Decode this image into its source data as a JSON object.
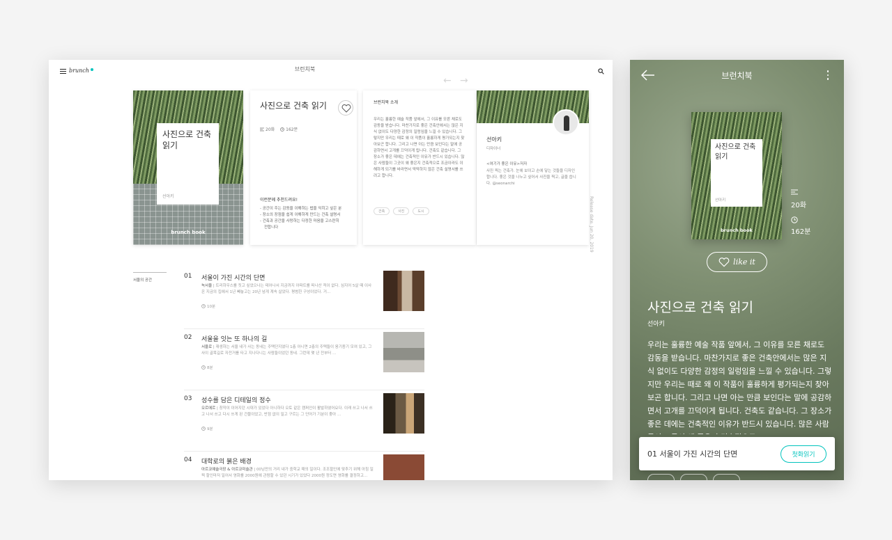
{
  "desktop": {
    "header": {
      "logo": "brunch",
      "title": "브런치북"
    },
    "nav": {
      "prev": "←",
      "next": "→"
    },
    "cover": {
      "title": "사진으로 건축 읽기",
      "author": "선아키",
      "brand": "brunch book"
    },
    "info": {
      "title": "사진으로 건축 읽기",
      "episodes": "20화",
      "duration": "162분",
      "recommend_head": "이런분께 추천드려요!",
      "recommend": [
        "- 공간이 주는 감동을 이해하는 법을 익히고 싶은 분",
        "- 장소의 장점을 쉽게 이해하게 만드는 건축 설명서",
        "- 건축과 공간을 사랑하는 다정한 마음을 고스란히",
        "전합니다"
      ]
    },
    "intro": {
      "head": "브런치북 소개",
      "body": "우리는 훌륭한 예술 작품 앞에서, 그 이유를 모른 채로도 감동을 받습니다. 마찬가지로 좋은 건축안에서는 많은 지식 없이도 다양한 감정의 일렁임을 느낄 수 있습니다. 그렇지만 우리는 때로 왜 이 작품이 훌륭하게 평가되는지 찾아보곤 합니다. 그리고 나면 아는 만큼 보인다는 말에 공감하면서 고개를 끄덕이게 됩니다. 건축도 같습니다. 그 장소가 좋은 데에는 건축적인 이유가 반드시 있습니다. 많은 사람들이 그곳이 왜 좋은지 건축적으로 조금이라도 이해하게 되기를 바라면서 딱딱하지 않은 건축 설명서를 쓰려고 합니다.",
      "tags": [
        "건축",
        "사진",
        "도시"
      ]
    },
    "author": {
      "name": "선아키",
      "role": "디자이너",
      "why": "<여기가 좋은 이유>저자",
      "bio": "사진 찍는 건축가. 눈에 보이고 손에 닿는 것들을 디자인합니다. 좋은 것을 나누고 싶어서 사진을 찍고, 글을 씁니다. @seonarchi"
    },
    "release": "Release date. Jun 20. 2019",
    "toc_label": "서울의 공간",
    "toc": [
      {
        "num": "01",
        "title": "서울이 가진 시간의 단면",
        "place": "녹서울",
        "desc": "트리하우스를 짓고 싶었으나는 테어나서 지금까지 아파트를 떠나산 적이 없다. 심지어 5살 때 이사 온 지금의 집에서 1년 빼놓고는 20년 넘게 계속 살았다. 평범한 구성이었다. 거…",
        "time": "10분"
      },
      {
        "num": "02",
        "title": "서울을 잇는 또 하나의 길",
        "place": "서울로",
        "desc": "재생하는 서울 내가 사는 동네는 주택단지였다 1층 아니면 2층의 주택들이 옹기종기 모여 있고, 그 사이 골목길로 자전거를 타고 지나다니는 사람들이었던 동네. 그런데 몇 년 전부터 …",
        "time": "8분"
      },
      {
        "num": "03",
        "title": "성수를 담은 디테일의 정수",
        "place": "오르에르",
        "desc": "창작이 이어지던 시대가 있었다 아니하다 오토 같은 캠퍼인이 활발하였어요다. 이래 쓰고 나서 쓰고 나서 쓰고 다시 쓰게 된 건물이었고, 반점 없이 밀고 구르는 그 단어가 기분이 좋아 …",
        "time": "9분"
      },
      {
        "num": "04",
        "title": "대학로의 붉은 배경",
        "place": "아르코예술극장 & 아르코미술관",
        "desc": "00님만의 거리 내가 중학교 때의 일이다. 조조할인에 맞추기 위해 아침 일찍 할인마저 일어서 영화를 2000원에 관람할 수 있던 시기가 있었다 2000원 정도면 영화를 결정하고…",
        "time": ""
      }
    ]
  },
  "mobile": {
    "title": "브런치북",
    "cover": {
      "title": "사진으로 건축 읽기",
      "author": "선아키",
      "brand": "brunch book"
    },
    "episodes": "20화",
    "duration": "162분",
    "like_label": "like it",
    "book_title": "사진으로 건축 읽기",
    "author": "선아키",
    "body": "우리는 훌륭한 예술 작품 앞에서, 그 이유를 모른 채로도 감동을 받습니다. 마찬가지로 좋은 건축안에서는 많은 지식 없이도 다양한 감정의 일렁임을 느낄 수 있습니다. 그렇지만 우리는 때로 왜 이 작품이 훌륭하게 평가되는지 찾아보곤 합니다. 그리고 나면 아는 만큼 보인다는 말에 공감하면서 고개를 끄덕이게 됩니다. 건축도 같습니다. 그 장소가 좋은 데에는 건축적인 이유가 반드시 있습니다. 많은 사람들이 그곳이 왜 좋은지 건축적으로",
    "popup": {
      "text": "01  서울이 가진 시간의 단면",
      "button": "첫화읽기"
    }
  },
  "colors": {
    "accent": "#00c3bd",
    "background": "#f4f4f4",
    "mobile_bg": "#7f8f72"
  }
}
